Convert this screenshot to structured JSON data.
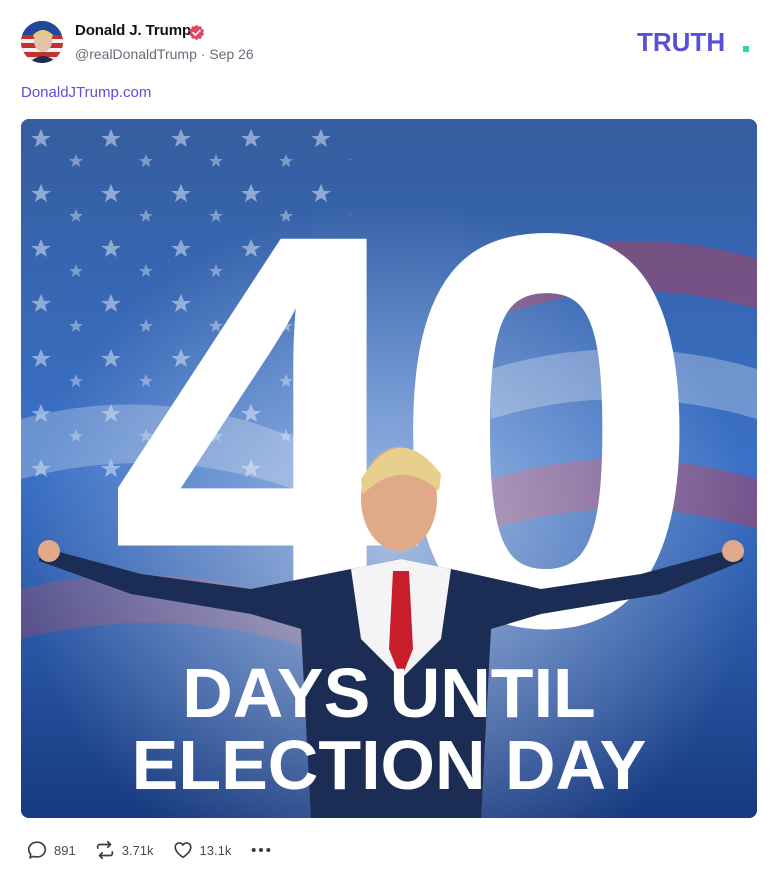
{
  "post": {
    "author_name": "Donald J. Trump",
    "handle": "@realDonaldTrump",
    "separator": "·",
    "date": "Sep 26",
    "link_text": "DonaldJTrump.com",
    "verified": true
  },
  "brand": {
    "logo_text": "TRUTH",
    "colors": {
      "accent": "#5b4fd6",
      "dot": "#2ed6b0"
    }
  },
  "image": {
    "big_number": "40",
    "line1": "DAYS UNTIL",
    "line2": "ELECTION DAY"
  },
  "actions": {
    "replies": "891",
    "retruths": "3.71k",
    "likes": "13.1k",
    "more_icon": "ellipsis-icon"
  }
}
